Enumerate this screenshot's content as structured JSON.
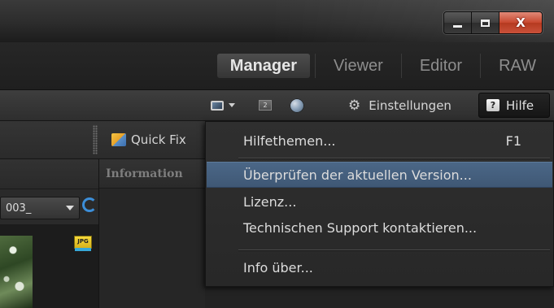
{
  "window": {
    "minimize_icon": "minimize-icon",
    "maximize_icon": "maximize-icon",
    "close_label": "X"
  },
  "modes": {
    "tabs": [
      {
        "label": "Manager",
        "active": true
      },
      {
        "label": "Viewer",
        "active": false
      },
      {
        "label": "Editor",
        "active": false
      },
      {
        "label": "RAW",
        "active": false
      }
    ]
  },
  "toolbar": {
    "settings_label": "Einstellungen",
    "help_label": "Hilfe",
    "help_glyph": "?",
    "screen_badge": "2"
  },
  "panels": {
    "quickfix_label": "Quick Fix",
    "info_title": "Information",
    "file_dropdown_value": "003_",
    "badge_text": "JPG"
  },
  "help_menu": {
    "items": [
      {
        "label": "Hilfethemen...",
        "shortcut": "F1"
      },
      {
        "label": "Überprüfen der aktuellen Version...",
        "shortcut": ""
      },
      {
        "label": "Lizenz...",
        "shortcut": ""
      },
      {
        "label": "Technischen Support kontaktieren...",
        "shortcut": ""
      },
      {
        "label": "Info über...",
        "shortcut": ""
      }
    ],
    "highlighted_index": 1
  },
  "colors": {
    "highlight": "#4b6787",
    "refresh_blue": "#3c8ed8",
    "close_red": "#c8472e"
  }
}
